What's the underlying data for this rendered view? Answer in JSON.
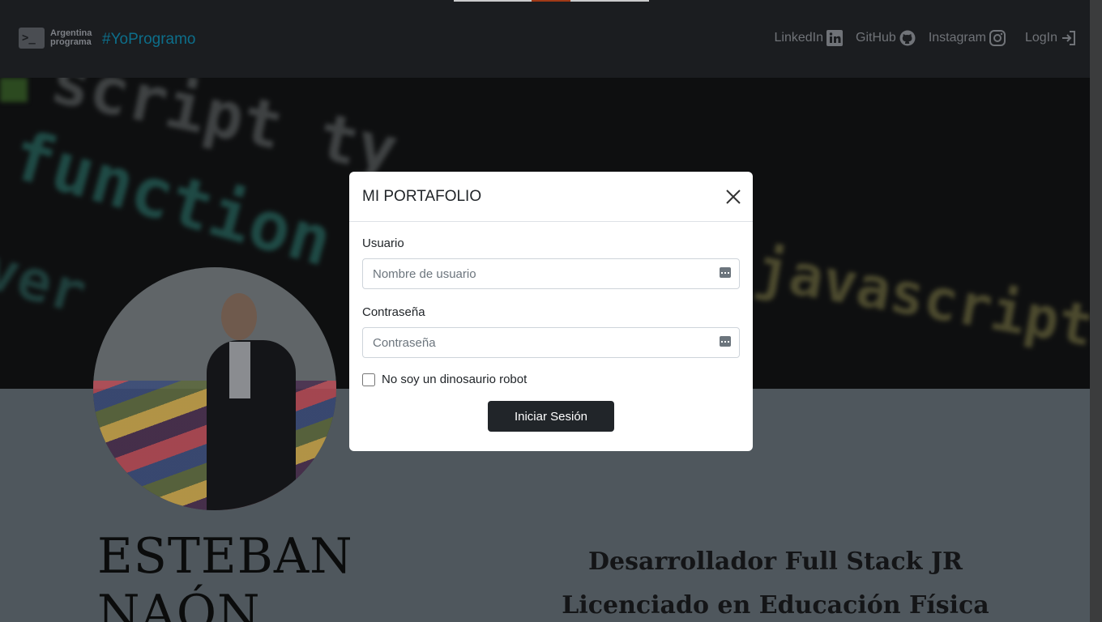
{
  "navbar": {
    "brand_line1": "Argentina",
    "brand_line2": "programa",
    "brand_icon": "terminal-icon",
    "tagline": "#YoProgramo",
    "links": [
      {
        "label": "LinkedIn",
        "icon": "linkedin-icon"
      },
      {
        "label": "GitHub",
        "icon": "github-icon"
      },
      {
        "label": "Instagram",
        "icon": "instagram-icon"
      },
      {
        "label": "LogIn",
        "icon": "login-icon"
      }
    ]
  },
  "profile": {
    "name_line1": "ESTEBAN",
    "name_line2": "NAÓN",
    "role1": "Desarrollador Full Stack JR",
    "role2": "Licenciado en Educación Física"
  },
  "modal": {
    "title": "MI PORTAFOLIO",
    "user_label": "Usuario",
    "user_placeholder": "Nombre de usuario",
    "password_label": "Contraseña",
    "password_placeholder": "Contraseña",
    "checkbox_label": "No soy un dinosaurio robot",
    "submit_label": "Iniciar Sesión"
  },
  "colors": {
    "navbar_bg": "#1b1d20",
    "tagline": "#0d6e8a",
    "button_bg": "#212529"
  }
}
